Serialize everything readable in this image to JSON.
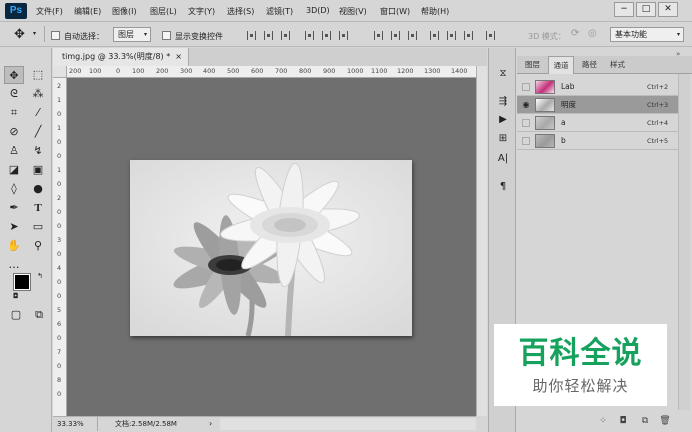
{
  "app": {
    "logo": "Ps"
  },
  "menu": [
    "文件(F)",
    "编辑(E)",
    "图像(I)",
    "图层(L)",
    "文字(Y)",
    "选择(S)",
    "滤镜(T)",
    "3D(D)",
    "视图(V)",
    "窗口(W)",
    "帮助(H)"
  ],
  "window_controls": {
    "minimize": "−",
    "maximize": "□",
    "close": "✕"
  },
  "options": {
    "auto_select_label": "自动选择：",
    "auto_select_value": "图层",
    "show_transform_label": "显示变换控件",
    "mode_3d_label": "3D 模式：",
    "workspace_value": "基本功能"
  },
  "document": {
    "tab_title": "timg.jpg @ 33.3%(明度/8) *",
    "close_glyph": "×",
    "zoom": "33.33%",
    "doc_info": "文档:2.58M/2.58M",
    "ruler_top": [
      "200",
      "100",
      "0",
      "100",
      "200",
      "300",
      "400",
      "500",
      "600",
      "700",
      "800",
      "900",
      "1000",
      "1100",
      "1200",
      "1300",
      "1400"
    ],
    "ruler_left": [
      "2",
      "1",
      "0",
      "1",
      "0",
      "0",
      "1",
      "0",
      "2",
      "0",
      "0",
      "3",
      "0",
      "4",
      "0",
      "0",
      "5",
      "6",
      "0",
      "7",
      "0",
      "8",
      "0"
    ]
  },
  "panel": {
    "tabs": [
      "图层",
      "通道",
      "路径",
      "样式"
    ],
    "active_tab": "通道",
    "channels": [
      {
        "name": "Lab",
        "shortcut": "Ctrl+2",
        "visible": false,
        "selected": false
      },
      {
        "name": "明度",
        "shortcut": "Ctrl+3",
        "visible": true,
        "selected": true
      },
      {
        "name": "a",
        "shortcut": "Ctrl+4",
        "visible": false,
        "selected": false
      },
      {
        "name": "b",
        "shortcut": "Ctrl+5",
        "visible": false,
        "selected": false
      }
    ]
  },
  "watermark": {
    "title": "百科全说",
    "subtitle": "助你轻松解决"
  },
  "colors": {
    "brand_green": "#16a15d",
    "canvas_bg": "#6f6f6f",
    "selected_row": "#9a9a9a"
  },
  "icons": {
    "tools": [
      "move-icon",
      "marquee-icon",
      "lasso-icon",
      "magic-wand-icon",
      "crop-icon",
      "eyedropper-icon",
      "healing-brush-icon",
      "brush-icon",
      "clone-stamp-icon",
      "history-brush-icon",
      "eraser-icon",
      "gradient-icon",
      "blur-icon",
      "dodge-icon",
      "pen-icon",
      "type-icon",
      "path-select-icon",
      "shape-icon",
      "hand-icon",
      "zoom-icon",
      "more-tools-icon",
      "color-swatch-icon",
      "quick-mask-icon",
      "screen-mode-icon"
    ],
    "mid_strip": [
      "history-icon",
      "actions-icon",
      "play-icon",
      "properties-icon",
      "character-icon",
      "paragraph-icon"
    ]
  }
}
